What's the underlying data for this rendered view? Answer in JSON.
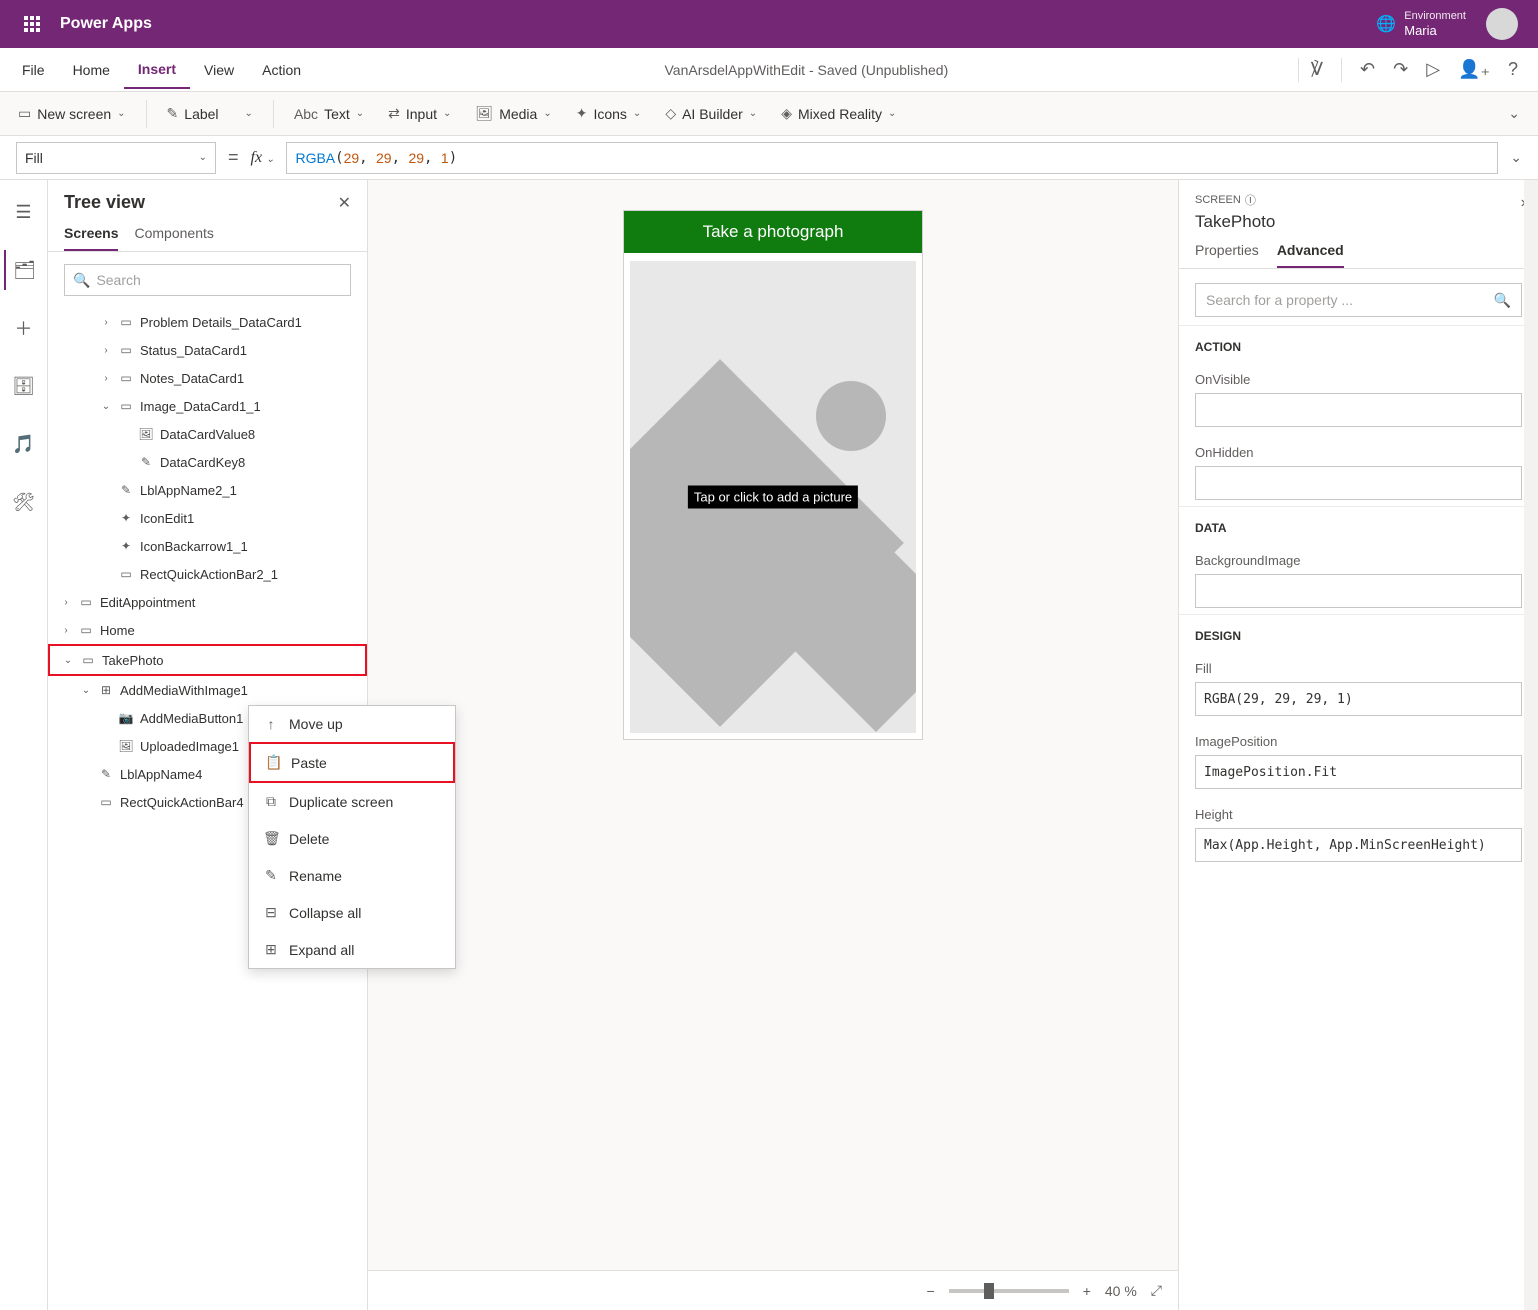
{
  "topbar": {
    "app_title": "Power Apps",
    "env_label": "Environment",
    "env_name": "Maria"
  },
  "menubar": {
    "items": [
      "File",
      "Home",
      "Insert",
      "View",
      "Action"
    ],
    "active_index": 2,
    "doc_title": "VanArsdelAppWithEdit - Saved (Unpublished)"
  },
  "toolbar": {
    "new_screen": "New screen",
    "label": "Label",
    "text": "Text",
    "input": "Input",
    "media": "Media",
    "icons": "Icons",
    "ai_builder": "AI Builder",
    "mixed_reality": "Mixed Reality"
  },
  "formula": {
    "property": "Fill",
    "fx_value_html": "RGBA(29, 29, 29, 1)",
    "fn": "RGBA",
    "args": [
      "29",
      "29",
      "29",
      "1"
    ]
  },
  "tree": {
    "title": "Tree view",
    "tabs": [
      "Screens",
      "Components"
    ],
    "active_tab": 0,
    "search_placeholder": "Search",
    "items": [
      {
        "label": "Problem Details_DataCard1",
        "indent": 2,
        "chev": "›",
        "icon": "card"
      },
      {
        "label": "Status_DataCard1",
        "indent": 2,
        "chev": "›",
        "icon": "card"
      },
      {
        "label": "Notes_DataCard1",
        "indent": 2,
        "chev": "›",
        "icon": "card"
      },
      {
        "label": "Image_DataCard1_1",
        "indent": 2,
        "chev": "⌄",
        "icon": "card"
      },
      {
        "label": "DataCardValue8",
        "indent": 3,
        "chev": "",
        "icon": "image"
      },
      {
        "label": "DataCardKey8",
        "indent": 3,
        "chev": "",
        "icon": "edit"
      },
      {
        "label": "LblAppName2_1",
        "indent": 2,
        "chev": "",
        "icon": "edit"
      },
      {
        "label": "IconEdit1",
        "indent": 2,
        "chev": "",
        "icon": "icons"
      },
      {
        "label": "IconBackarrow1_1",
        "indent": 2,
        "chev": "",
        "icon": "icons"
      },
      {
        "label": "RectQuickActionBar2_1",
        "indent": 2,
        "chev": "",
        "icon": "rect"
      },
      {
        "label": "EditAppointment",
        "indent": 0,
        "chev": "›",
        "icon": "screen"
      },
      {
        "label": "Home",
        "indent": 0,
        "chev": "›",
        "icon": "screen"
      },
      {
        "label": "TakePhoto",
        "indent": 0,
        "chev": "⌄",
        "icon": "screen",
        "highlight": true
      },
      {
        "label": "AddMediaWithImage1",
        "indent": 1,
        "chev": "⌄",
        "icon": "group"
      },
      {
        "label": "AddMediaButton1",
        "indent": 2,
        "chev": "",
        "icon": "media"
      },
      {
        "label": "UploadedImage1",
        "indent": 2,
        "chev": "",
        "icon": "image"
      },
      {
        "label": "LblAppName4",
        "indent": 1,
        "chev": "",
        "icon": "edit"
      },
      {
        "label": "RectQuickActionBar4",
        "indent": 1,
        "chev": "",
        "icon": "rect"
      }
    ]
  },
  "context_menu": {
    "items": [
      {
        "label": "Move up",
        "icon": "↑"
      },
      {
        "label": "Paste",
        "icon": "📋",
        "highlight": true
      },
      {
        "label": "Duplicate screen",
        "icon": "⧉"
      },
      {
        "label": "Delete",
        "icon": "🗑"
      },
      {
        "label": "Rename",
        "icon": "✎"
      },
      {
        "label": "Collapse all",
        "icon": "⊟"
      },
      {
        "label": "Expand all",
        "icon": "⊞"
      }
    ]
  },
  "canvas": {
    "header_label": "Take a photograph",
    "tap_label": "Tap or click to add a picture",
    "zoom_value": "40",
    "zoom_unit": "%"
  },
  "props": {
    "type_label": "SCREEN",
    "name": "TakePhoto",
    "tabs": [
      "Properties",
      "Advanced"
    ],
    "active_tab": 1,
    "search_placeholder": "Search for a property ...",
    "sections": {
      "action": {
        "title": "ACTION",
        "props": [
          {
            "label": "OnVisible",
            "value": ""
          },
          {
            "label": "OnHidden",
            "value": ""
          }
        ]
      },
      "data": {
        "title": "DATA",
        "props": [
          {
            "label": "BackgroundImage",
            "value": ""
          }
        ]
      },
      "design": {
        "title": "DESIGN",
        "props": [
          {
            "label": "Fill",
            "value": "RGBA(29, 29, 29, 1)"
          },
          {
            "label": "ImagePosition",
            "value": "ImagePosition.Fit"
          },
          {
            "label": "Height",
            "value": "Max(App.Height, App.MinScreenHeight)"
          }
        ]
      }
    }
  }
}
